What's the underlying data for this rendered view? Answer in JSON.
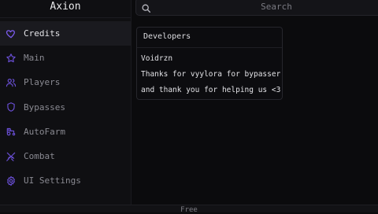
{
  "app": {
    "title": "Axion",
    "accent_color": "#7c5cf0"
  },
  "search": {
    "placeholder": "Search",
    "icon": "search-icon"
  },
  "sidebar": {
    "items": [
      {
        "label": "Credits",
        "icon": "heart-icon",
        "active": true
      },
      {
        "label": "Main",
        "icon": "star-icon",
        "active": false
      },
      {
        "label": "Players",
        "icon": "users-icon",
        "active": false
      },
      {
        "label": "Bypasses",
        "icon": "shield-icon",
        "active": false
      },
      {
        "label": "AutoFarm",
        "icon": "tractor-icon",
        "active": false
      },
      {
        "label": "Combat",
        "icon": "swords-icon",
        "active": false
      },
      {
        "label": "UI Settings",
        "icon": "gear-icon",
        "active": false
      }
    ]
  },
  "main": {
    "card": {
      "title": "Developers",
      "lines": [
        "Voidrzn",
        "Thanks for vyylora for bypasser",
        "and thank you for helping us <3"
      ]
    }
  },
  "footer": {
    "text": "Free"
  }
}
